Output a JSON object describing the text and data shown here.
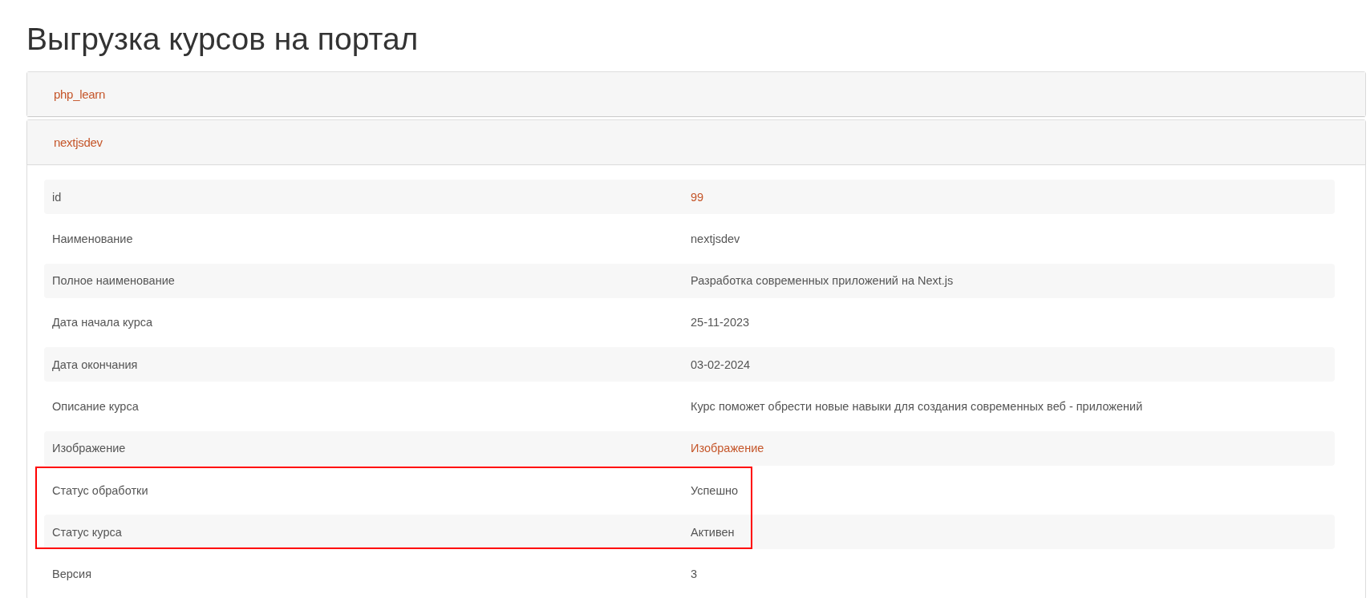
{
  "page": {
    "title": "Выгрузка курсов на портал"
  },
  "courses": [
    {
      "title": "php_learn",
      "expanded": false
    },
    {
      "title": "nextjsdev",
      "expanded": true,
      "fields": [
        {
          "label": "id",
          "value": "99",
          "kind": "link",
          "highlighted": false
        },
        {
          "label": "Наименование",
          "value": "nextjsdev",
          "kind": "text",
          "highlighted": false
        },
        {
          "label": "Полное наименование",
          "value": "Разработка современных приложений на Next.js",
          "kind": "text",
          "highlighted": false
        },
        {
          "label": "Дата начала курса",
          "value": "25-11-2023",
          "kind": "text",
          "highlighted": false
        },
        {
          "label": "Дата окончания",
          "value": "03-02-2024",
          "kind": "text",
          "highlighted": false
        },
        {
          "label": "Описание курса",
          "value": "Курс поможет обрести новые навыки для создания современных веб - приложений",
          "kind": "text",
          "highlighted": false
        },
        {
          "label": "Изображение",
          "value": "Изображение",
          "kind": "link",
          "highlighted": false
        },
        {
          "label": "Статус обработки",
          "value": "Успешно",
          "kind": "text",
          "highlighted": true
        },
        {
          "label": "Статус курса",
          "value": "Активен",
          "kind": "text",
          "highlighted": true
        },
        {
          "label": "Версия",
          "value": "3",
          "kind": "text",
          "highlighted": false
        }
      ]
    }
  ]
}
